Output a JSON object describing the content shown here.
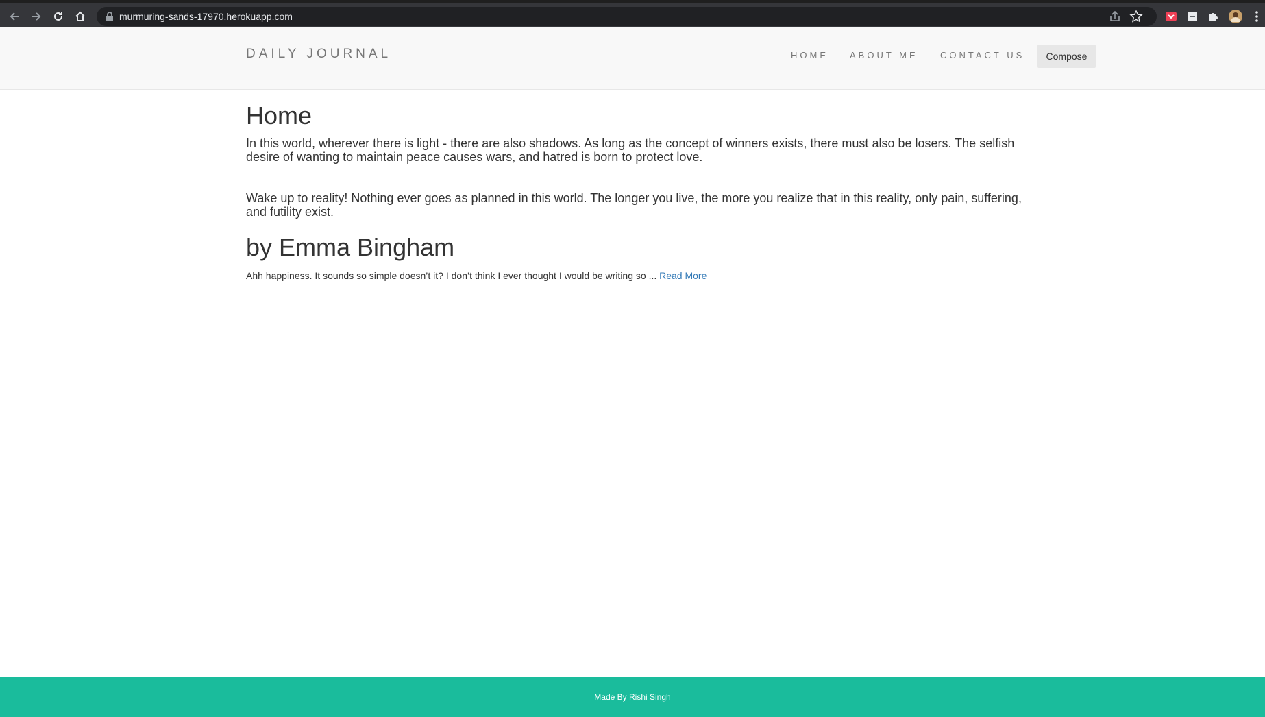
{
  "browser": {
    "url": "murmuring-sands-17970.herokuapp.com"
  },
  "header": {
    "brand": "DAILY JOURNAL",
    "nav": [
      {
        "label": "HOME"
      },
      {
        "label": "ABOUT ME"
      },
      {
        "label": "CONTACT US"
      }
    ],
    "compose_label": "Compose"
  },
  "main": {
    "title": "Home",
    "paragraphs": [
      "In this world, wherever there is light - there are also shadows. As long as the concept of winners exists, there must also be losers. The selfish desire of wanting to maintain peace causes wars, and hatred is born to protect love.",
      "Wake up to reality! Nothing ever goes as planned in this world. The longer you live, the more you realize that in this reality, only pain, suffering, and futility exist."
    ],
    "post": {
      "title": "by Emma Bingham",
      "excerpt": "Ahh happiness. It sounds so simple doesn’t it? I don’t think I ever thought I would be writing so ... ",
      "read_more": "Read More"
    }
  },
  "footer": {
    "text": "Made By Rishi Singh"
  },
  "colors": {
    "footer_bg": "#1abc9c",
    "link": "#337ab7",
    "header_bg": "#f8f8f8"
  }
}
